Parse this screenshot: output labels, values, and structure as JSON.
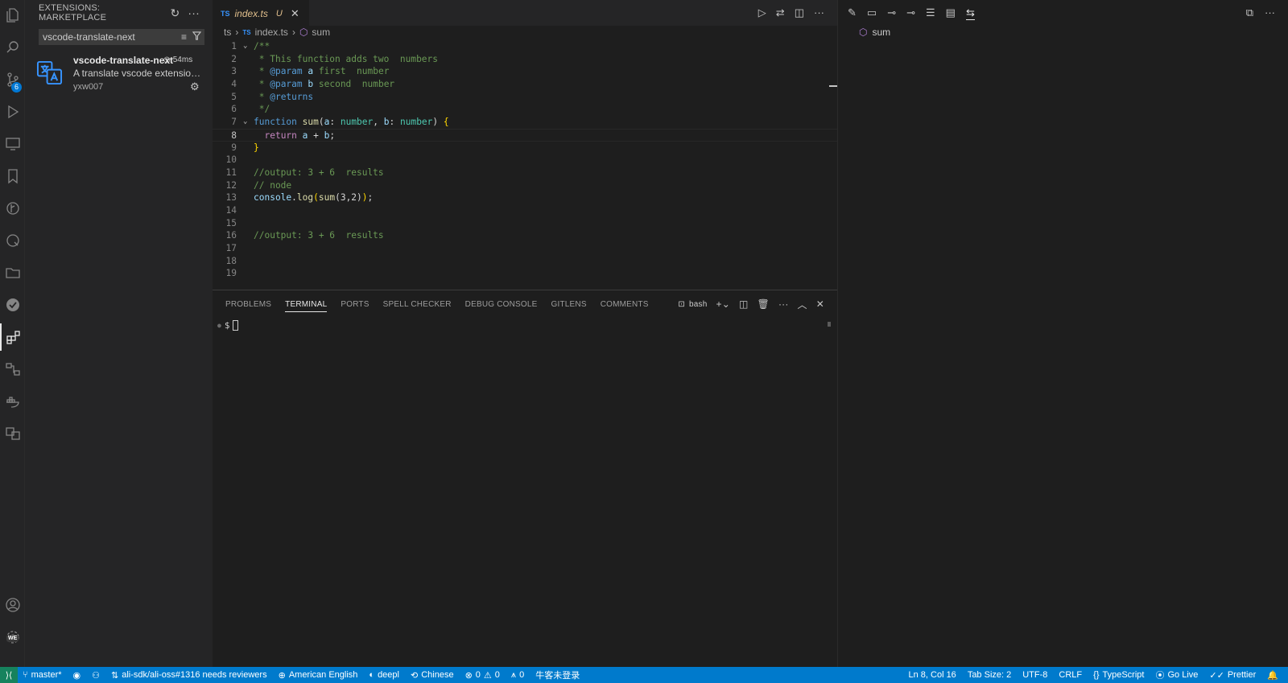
{
  "sidebar": {
    "title": "EXTENSIONS: MARKETPLACE",
    "search_value": "vscode-translate-next",
    "extension": {
      "name": "vscode-translate-next",
      "time": "54ms",
      "description": "A translate vscode extension th...",
      "author": "yxw007"
    }
  },
  "activity": {
    "scm_badge": "6",
    "account_badge": "WE"
  },
  "editor": {
    "tab": {
      "lang": "TS",
      "filename": "index.ts",
      "status": "U"
    },
    "breadcrumb": {
      "folder": "ts",
      "lang": "TS",
      "file": "index.ts",
      "symbol": "sum"
    }
  },
  "outline": {
    "symbol": "sum"
  },
  "panel": {
    "tabs": [
      "PROBLEMS",
      "TERMINAL",
      "PORTS",
      "SPELL CHECKER",
      "DEBUG CONSOLE",
      "GITLENS",
      "COMMENTS"
    ],
    "shell": "bash",
    "prompt": "$"
  },
  "statusbar": {
    "branch": "master*",
    "pr": "ali-sdk/ali-oss#1316 needs reviewers",
    "spell_lang": "American English",
    "translator": "deepl",
    "target_lang": "Chinese",
    "errors": "0",
    "warnings": "0",
    "ports": "0",
    "login": "牛客未登录",
    "cursor": "Ln 8, Col 16",
    "tab_size": "Tab Size: 2",
    "encoding": "UTF-8",
    "eol": "CRLF",
    "language": "TypeScript",
    "golive": "Go Live",
    "prettier": "Prettier"
  },
  "colors": {
    "accent": "#007acc",
    "remote": "#16825d",
    "background": "#1e1e1e",
    "sidebar": "#252526"
  }
}
